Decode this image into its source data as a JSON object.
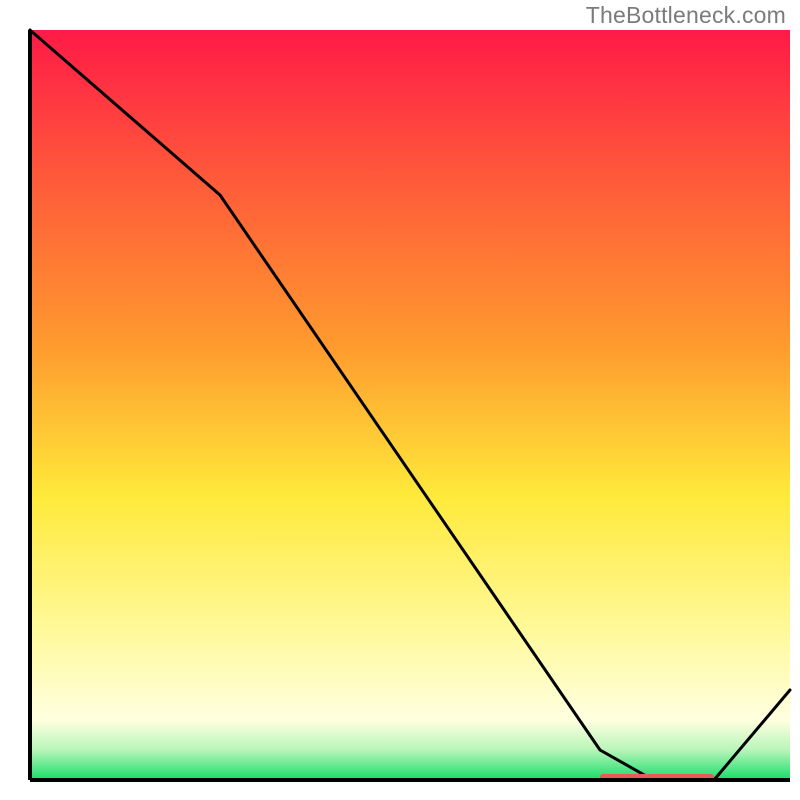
{
  "watermark": "TheBottleneck.com",
  "chart_data": {
    "type": "line",
    "title": "",
    "xlabel": "",
    "ylabel": "",
    "xlim": [
      0,
      100
    ],
    "ylim": [
      0,
      100
    ],
    "grid": false,
    "legend": false,
    "line": {
      "x": [
        0,
        25,
        75,
        82,
        90,
        100
      ],
      "y": [
        100,
        78,
        4,
        0,
        0,
        12
      ]
    },
    "marker": {
      "x_start": 75,
      "x_end": 90,
      "y": 0,
      "color": "#e85a5a"
    },
    "background_gradient": {
      "top": "#ff1a47",
      "mid1": "#ff8b2b",
      "mid2": "#ffe93a",
      "pale": "#ffffd0",
      "bottom": "#16dd6b"
    }
  }
}
